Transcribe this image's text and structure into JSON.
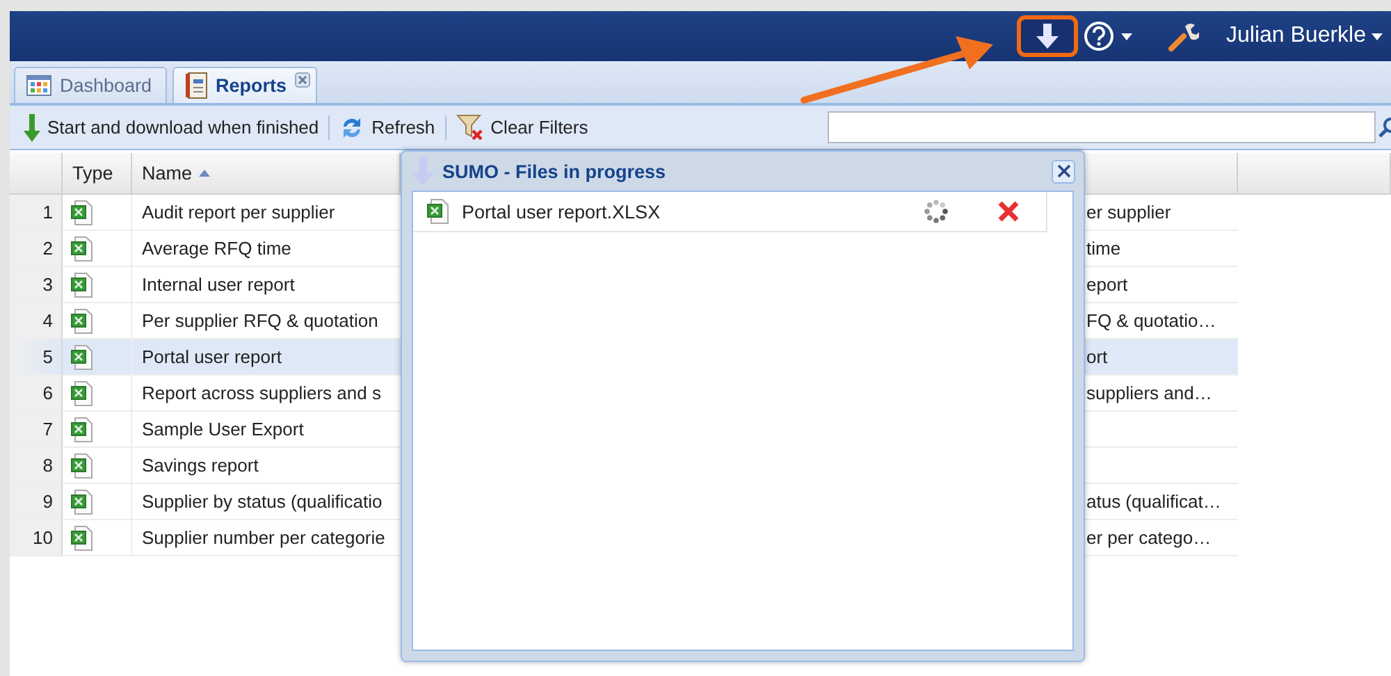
{
  "header": {
    "download_highlighted": true,
    "user": "Julian Buerkle"
  },
  "tabs": [
    {
      "label": "Dashboard",
      "kind": "dashboard",
      "selected": false,
      "closable": false
    },
    {
      "label": "Reports",
      "kind": "reports",
      "selected": true,
      "closable": true
    }
  ],
  "toolbar": [
    {
      "label": "Start and download when finished",
      "kind": "download"
    },
    {
      "label": "Refresh",
      "kind": "refresh"
    },
    {
      "label": "Clear Filters",
      "kind": "clear-filters"
    }
  ],
  "table": {
    "columns": [
      {
        "label": "Type"
      },
      {
        "label": "Name",
        "sorted_ascending": true
      }
    ],
    "rows": [
      {
        "number": "1",
        "kind": "xlsx",
        "name": "Audit report per supplier",
        "column_3": "er supplier",
        "selected": false
      },
      {
        "number": "2",
        "kind": "xlsx",
        "name": "Average RFQ time",
        "column_3": "time",
        "selected": false
      },
      {
        "number": "3",
        "kind": "xlsx",
        "name": "Internal user report",
        "column_3": "eport",
        "selected": false
      },
      {
        "number": "4",
        "kind": "xlsx",
        "name": "Per supplier RFQ & quotation",
        "column_3": "FQ & quotatio…",
        "selected": false
      },
      {
        "number": "5",
        "kind": "xlsx",
        "name": "Portal user report",
        "column_3": "ort",
        "selected": true
      },
      {
        "number": "6",
        "kind": "xlsx",
        "name": "Report across suppliers and s",
        "column_3": "suppliers and…",
        "selected": false
      },
      {
        "number": "7",
        "kind": "xlsx",
        "name": "Sample User Export",
        "selected": false
      },
      {
        "number": "8",
        "kind": "xlsx",
        "name": "Savings report",
        "selected": false
      },
      {
        "number": "9",
        "kind": "xlsx",
        "name": "Supplier by status (qualificatio",
        "column_3": "atus (qualificat…",
        "selected": false
      },
      {
        "number": "10",
        "kind": "xlsx",
        "name": "Supplier number per categorie",
        "column_3": "er per catego…",
        "selected": false
      }
    ]
  },
  "popup": {
    "title": "SUMO - Files in progress",
    "files": [
      {
        "name": "Portal user report.XLSX",
        "loading": true
      }
    ]
  }
}
